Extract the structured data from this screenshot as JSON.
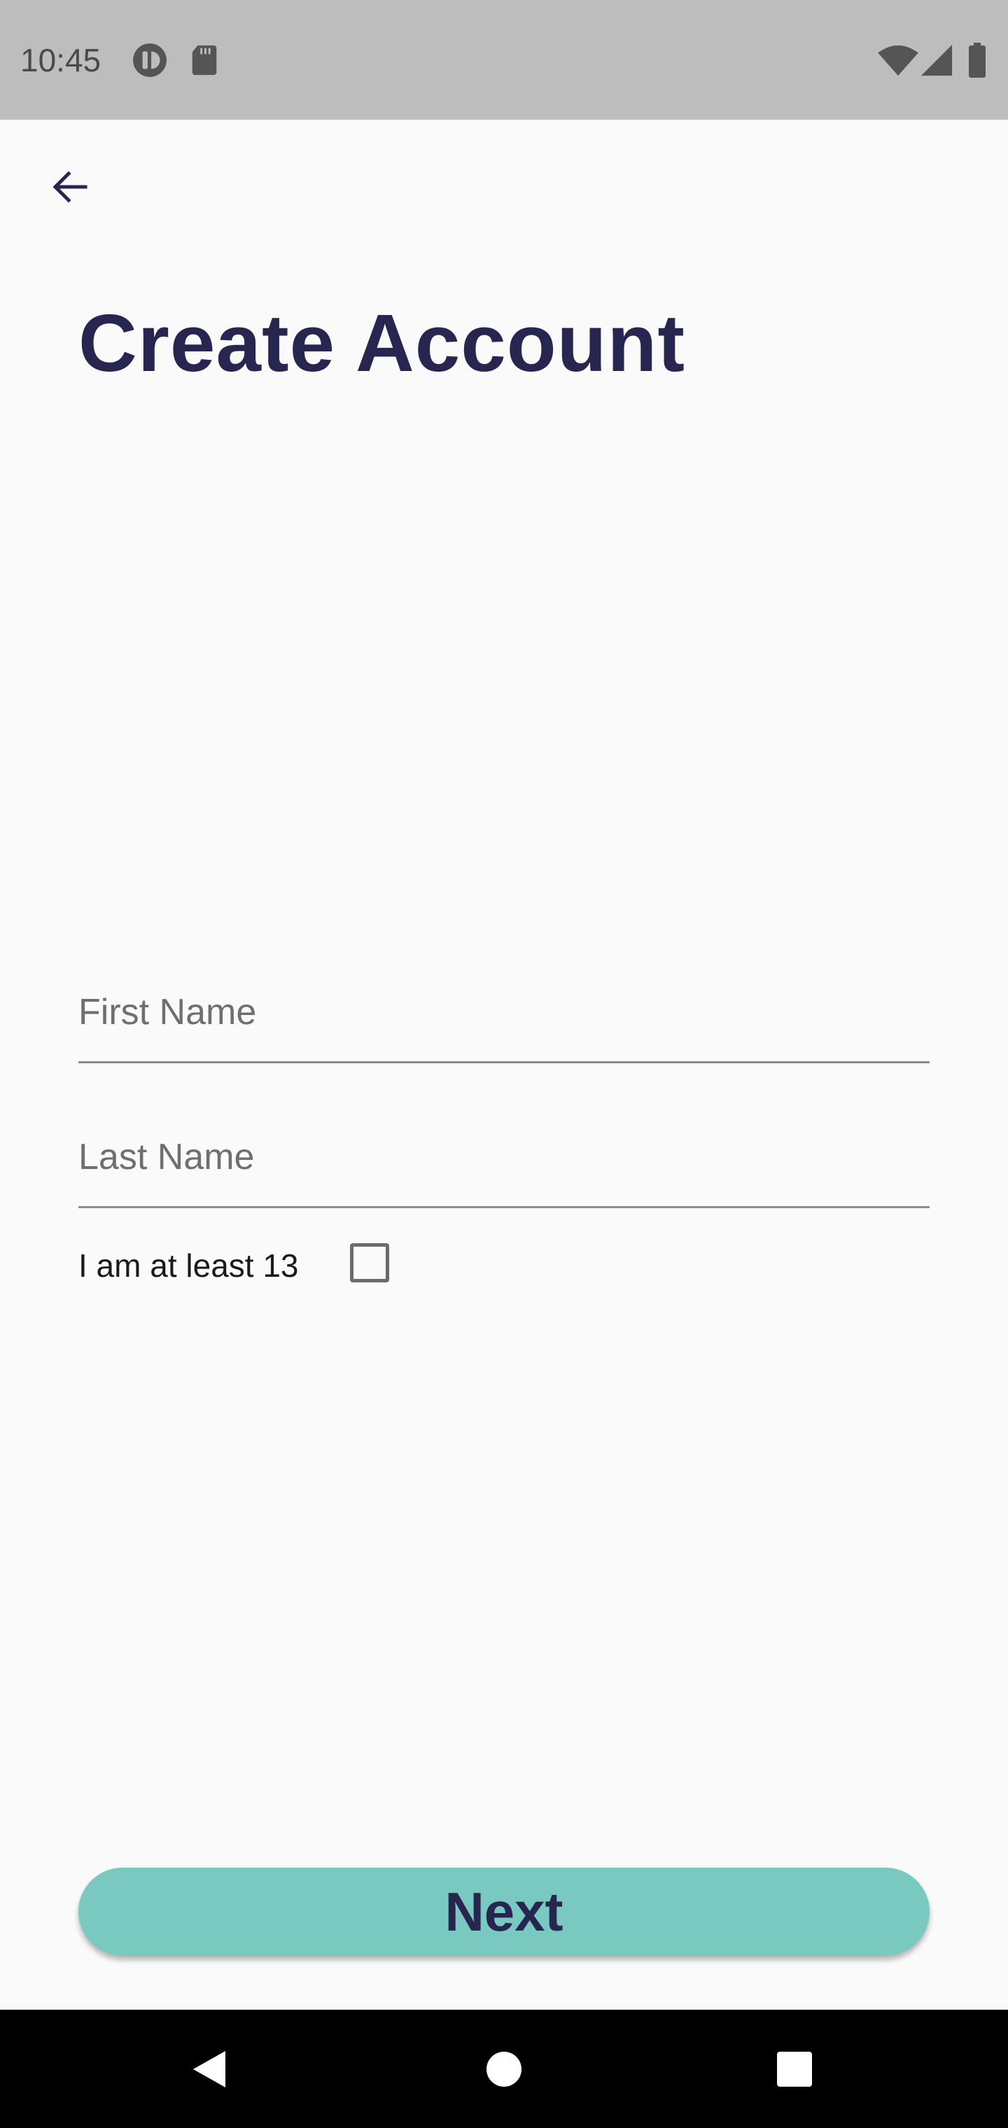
{
  "status_bar": {
    "time": "10:45",
    "left_icons": [
      "data-saver-icon",
      "sd-card-icon"
    ],
    "right_icons": [
      "wifi-icon",
      "cell-signal-icon",
      "battery-icon"
    ]
  },
  "app_bar": {
    "back_icon": "arrow-back-icon"
  },
  "form": {
    "title": "Create Account",
    "first_name": {
      "placeholder": "First Name",
      "value": ""
    },
    "last_name": {
      "placeholder": "Last Name",
      "value": ""
    },
    "age_confirm": {
      "label": "I am at least 13",
      "checked": false
    },
    "next_label": "Next"
  },
  "nav_bar": {
    "icons": [
      "nav-back-icon",
      "nav-home-icon",
      "nav-recents-icon"
    ]
  },
  "colors": {
    "status_bar_bg": "#bdbdbd",
    "background": "#fafafa",
    "title": "#262650",
    "accent_button": "#79c9c0",
    "nav_bar_bg": "#000000"
  }
}
